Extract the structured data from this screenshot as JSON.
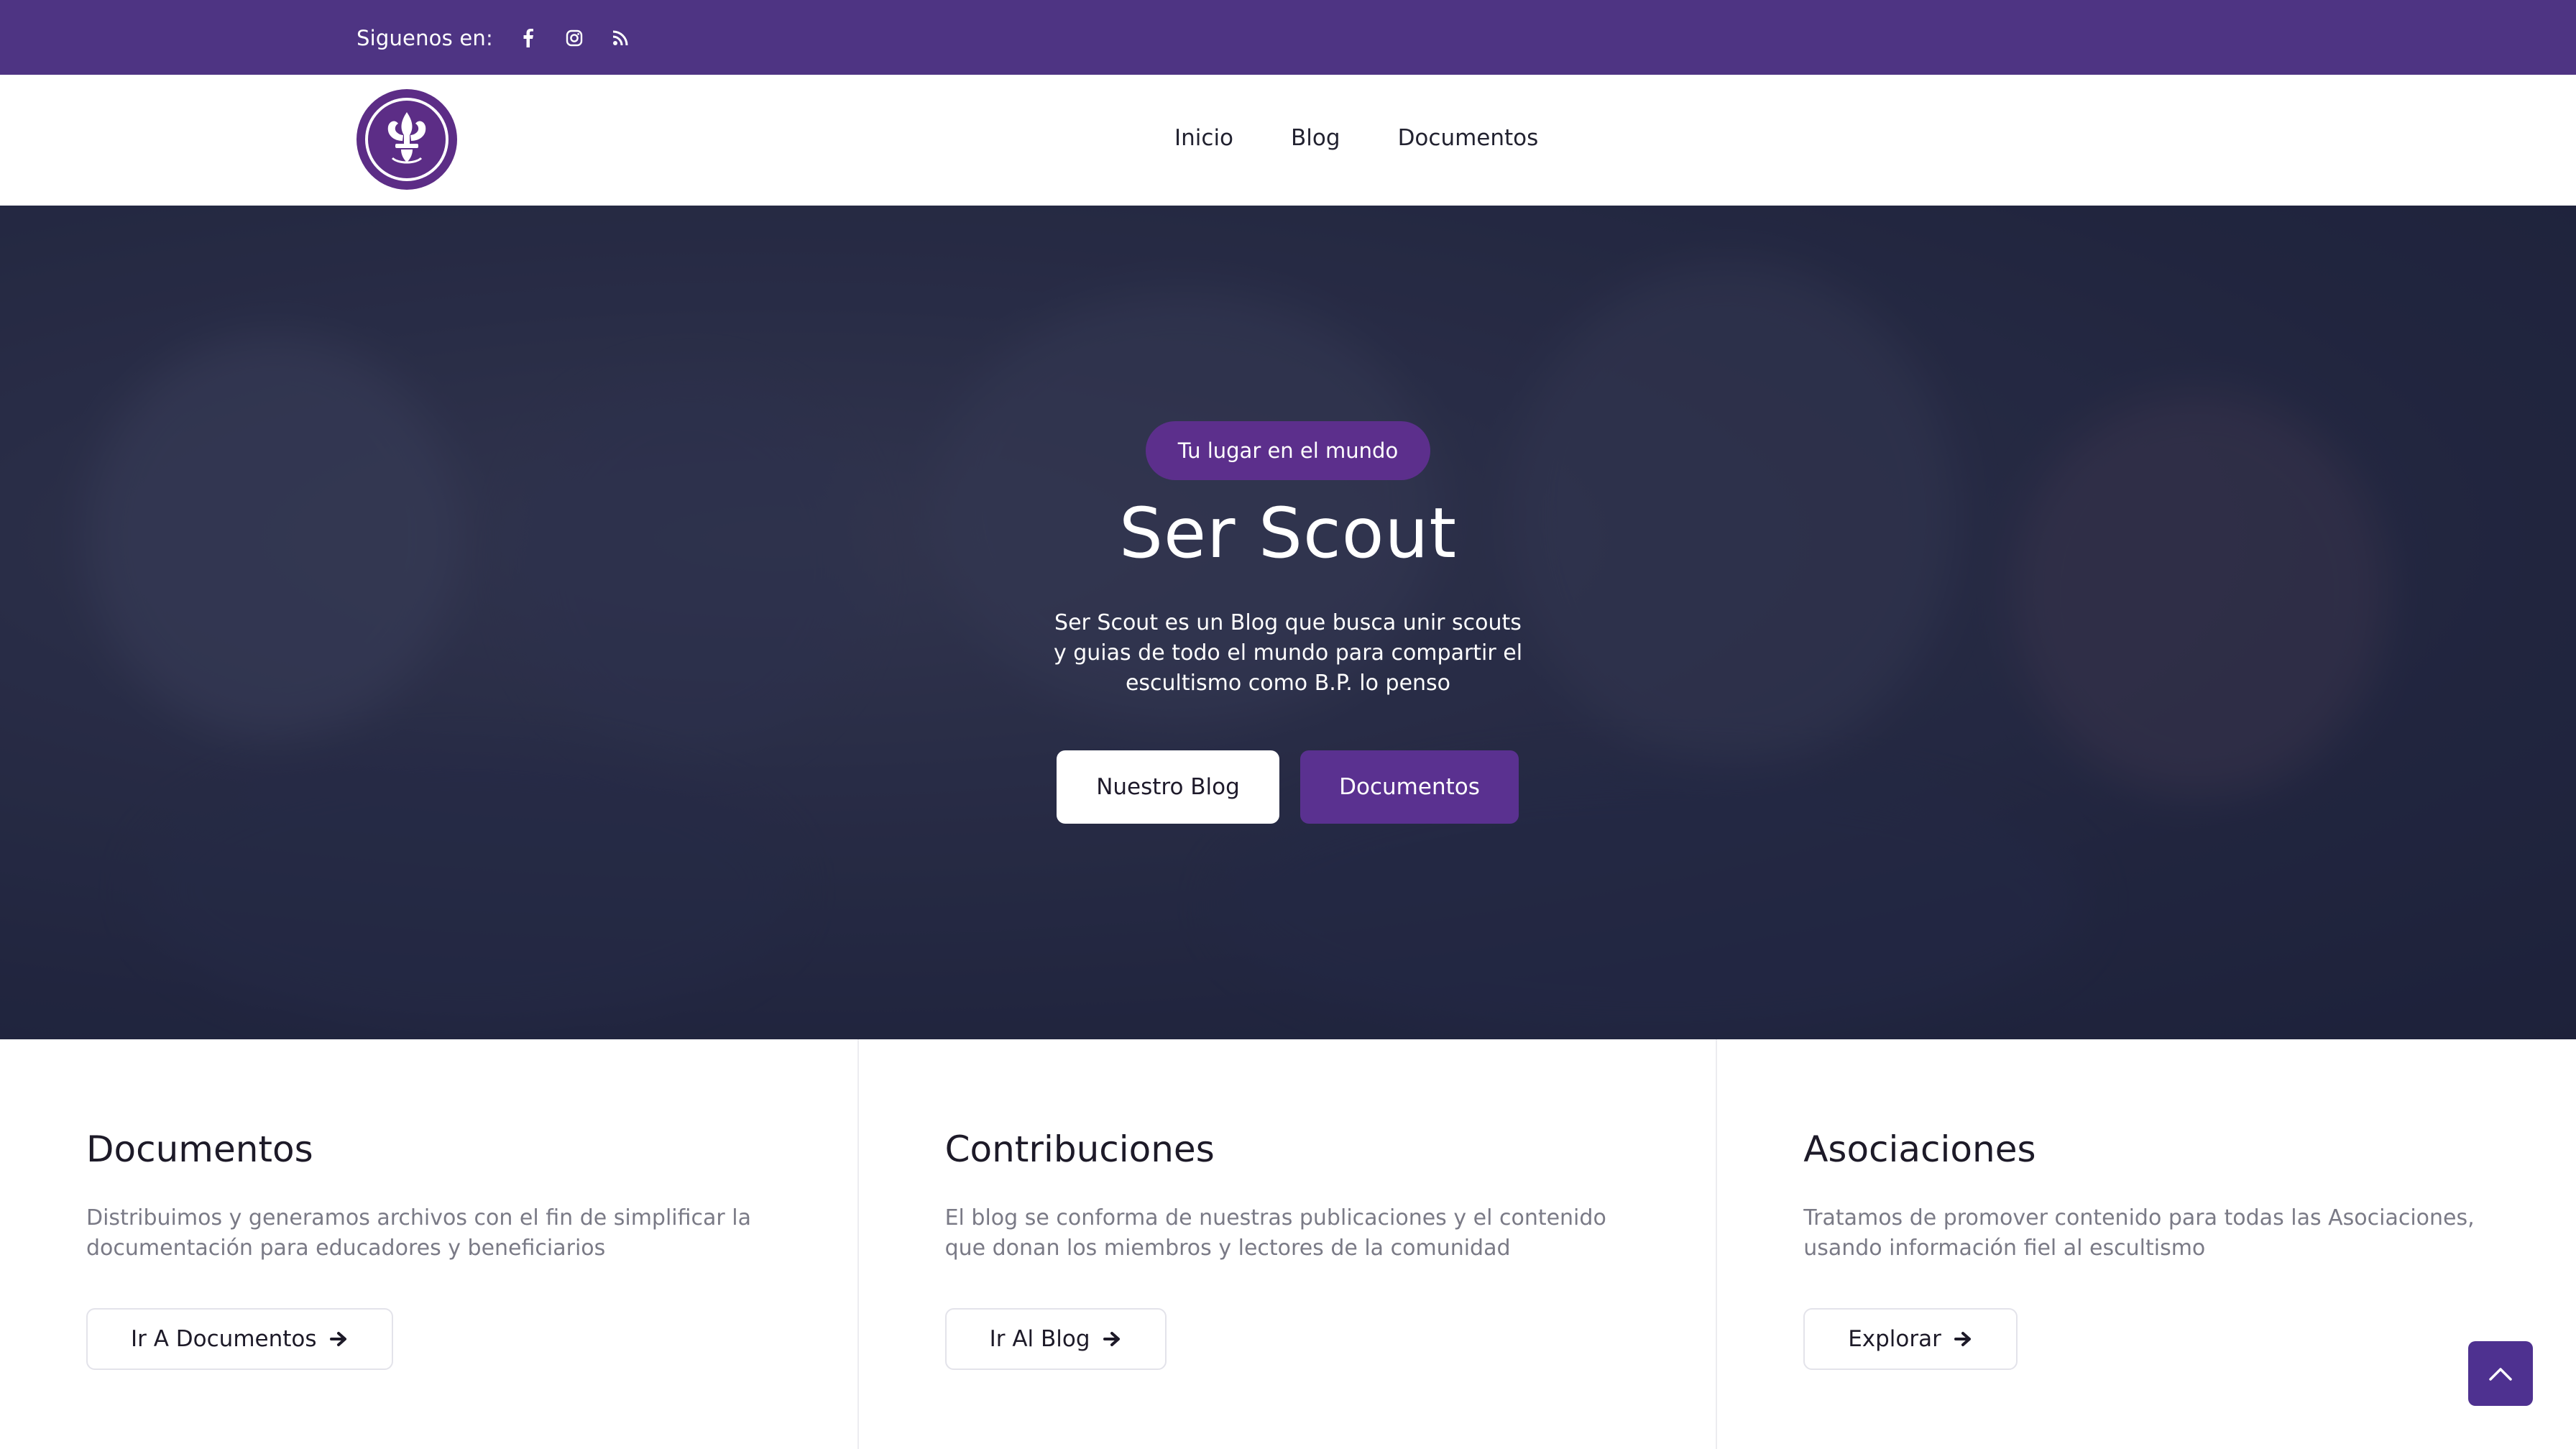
{
  "topbar": {
    "follow_label": "Siguenos en:",
    "social": [
      "facebook-icon",
      "instagram-icon",
      "rss-icon"
    ]
  },
  "nav": {
    "items": [
      "Inicio",
      "Blog",
      "Documentos"
    ]
  },
  "hero": {
    "pill": "Tu lugar en el mundo",
    "title": "Ser Scout",
    "description": "Ser Scout es un Blog que busca unir scouts y guias de todo el mundo para compartir el escultismo como B.P. lo penso",
    "primary_button": "Nuestro Blog",
    "secondary_button": "Documentos"
  },
  "features": [
    {
      "title": "Documentos",
      "text": "Distribuimos y generamos archivos con el fin de simplificar la documentación para educadores y beneficiarios",
      "button": "Ir A Documentos"
    },
    {
      "title": "Contribuciones",
      "text": "El blog se conforma de nuestras publicaciones y el contenido que donan los miembros y lectores de la comunidad",
      "button": "Ir Al Blog"
    },
    {
      "title": "Asociaciones",
      "text": "Tratamos de promover contenido para todas las Asociaciones, usando información fiel al escultismo",
      "button": "Explorar"
    }
  ],
  "colors": {
    "brand_purple": "#4e3483",
    "button_purple": "#5a3190",
    "hero_overlay": "#262b42"
  }
}
